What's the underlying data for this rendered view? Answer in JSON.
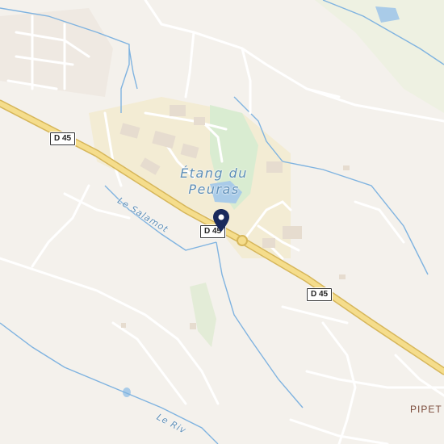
{
  "map": {
    "colors": {
      "background": "#f4f1ec",
      "urban": "#f3ecd4",
      "water": "#a9cbe8",
      "water_line": "#7fb3e0",
      "park": "#d9ecd1",
      "main_road": "#f0d27a",
      "main_road_casing": "#d6b65a",
      "minor_road": "#ffffff",
      "marker": "#1a2a5c"
    },
    "road_shields": [
      {
        "id": "d45-west",
        "text": "D 45"
      },
      {
        "id": "d45-center",
        "text": "D 45"
      },
      {
        "id": "d45-east",
        "text": "D 45"
      }
    ],
    "lake_label": {
      "line1": "Étang du",
      "line2": "Peuras"
    },
    "rivers": [
      {
        "id": "salamot",
        "text": "Le Salamot"
      },
      {
        "id": "riv",
        "text": "Le Riv"
      }
    ],
    "locality": {
      "text": "PIPET"
    },
    "marker": {
      "icon": "map-pin-icon"
    }
  }
}
